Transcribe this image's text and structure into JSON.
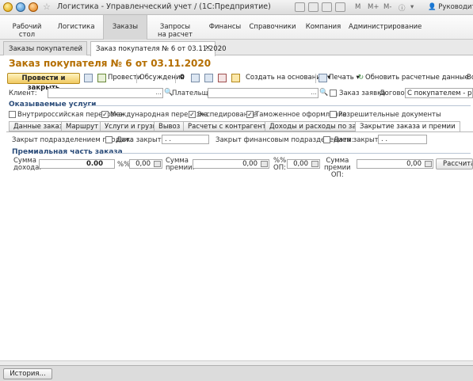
{
  "titlebar": {
    "title": "Логистика - Управленческий учет /  (1С:Предприятие)",
    "m_label": "M",
    "mplus_label": "M+",
    "mminus_label": "M-",
    "user": "Руководите..."
  },
  "sections": [
    {
      "line1": "Рабочий",
      "line2": "стол"
    },
    {
      "line1": "Логистика",
      "line2": ""
    },
    {
      "line1": "Заказы",
      "line2": ""
    },
    {
      "line1": "Запросы",
      "line2": "на расчет"
    },
    {
      "line1": "Финансы",
      "line2": ""
    },
    {
      "line1": "Справочники",
      "line2": ""
    },
    {
      "line1": "Компания",
      "line2": ""
    },
    {
      "line1": "Администрирование",
      "line2": ""
    }
  ],
  "open_tabs": [
    {
      "label": "Заказы покупателей"
    },
    {
      "label": "Заказ покупателя № 6 от 03.11.2020"
    }
  ],
  "doc_title": "Заказ покупателя № 6 от 03.11.2020",
  "toolbar": {
    "post_close": "Провести и закрыть",
    "post": "Провести",
    "discussions": "Обсуждения",
    "create_based": "Создать на основании",
    "print": "Печать",
    "refresh": "Обновить расчетные данные",
    "more": "Вс"
  },
  "header_row": {
    "client_label": "Клиент:",
    "client_value": "",
    "payer_label": "Плательщик:",
    "payer_value": "",
    "order_request_label": "Заказ заявка",
    "contract_label": "Договор:",
    "contract_value": "С покупателем - руб."
  },
  "services": {
    "title": "Оказываемые услуги",
    "items": [
      {
        "label": "Внутрироссийская перевозка",
        "checked": false
      },
      {
        "label": "Международная перевозка",
        "checked": true
      },
      {
        "label": "Экспедирование",
        "checked": true
      },
      {
        "label": "Таможенное оформление",
        "checked": true
      },
      {
        "label": "Разрешительные документы",
        "checked": false
      }
    ]
  },
  "tabs": [
    "Данные заказа",
    "Маршрут",
    "Услуги и грузы",
    "Вывоз",
    "Расчеты с контрагентами",
    "Доходы и расходы по заказу",
    "Закрытие заказа и премии"
  ],
  "closing": {
    "sales_closed_label": "Закрыт подразделением продаж:",
    "close_date_label": "Дата закрытия:",
    "close_date_value": ". .",
    "finance_closed_label": "Закрыт финансовым подразделением:",
    "close_date2_label": "Дата закрытия:",
    "close_date2_value": ". ."
  },
  "premium": {
    "title": "Премиальная часть заказа",
    "income_label_1": "Сумма",
    "income_label_2": "дохода:",
    "income_value": "0.00",
    "pct_label": "%%:",
    "pct_value": "0,00",
    "premium_label_1": "Сумма",
    "premium_label_2": "премии:",
    "premium_value": "0,00",
    "pct_op_label_1": "%%",
    "pct_op_label_2": "ОП:",
    "pct_op_value": "0,00",
    "premium_op_label_1": "Сумма",
    "premium_op_label_2": "премии",
    "premium_op_label_3": "ОП:",
    "premium_op_value": "0,00",
    "calc_button": "Рассчитать"
  },
  "bottom": {
    "history_button": "История..."
  }
}
